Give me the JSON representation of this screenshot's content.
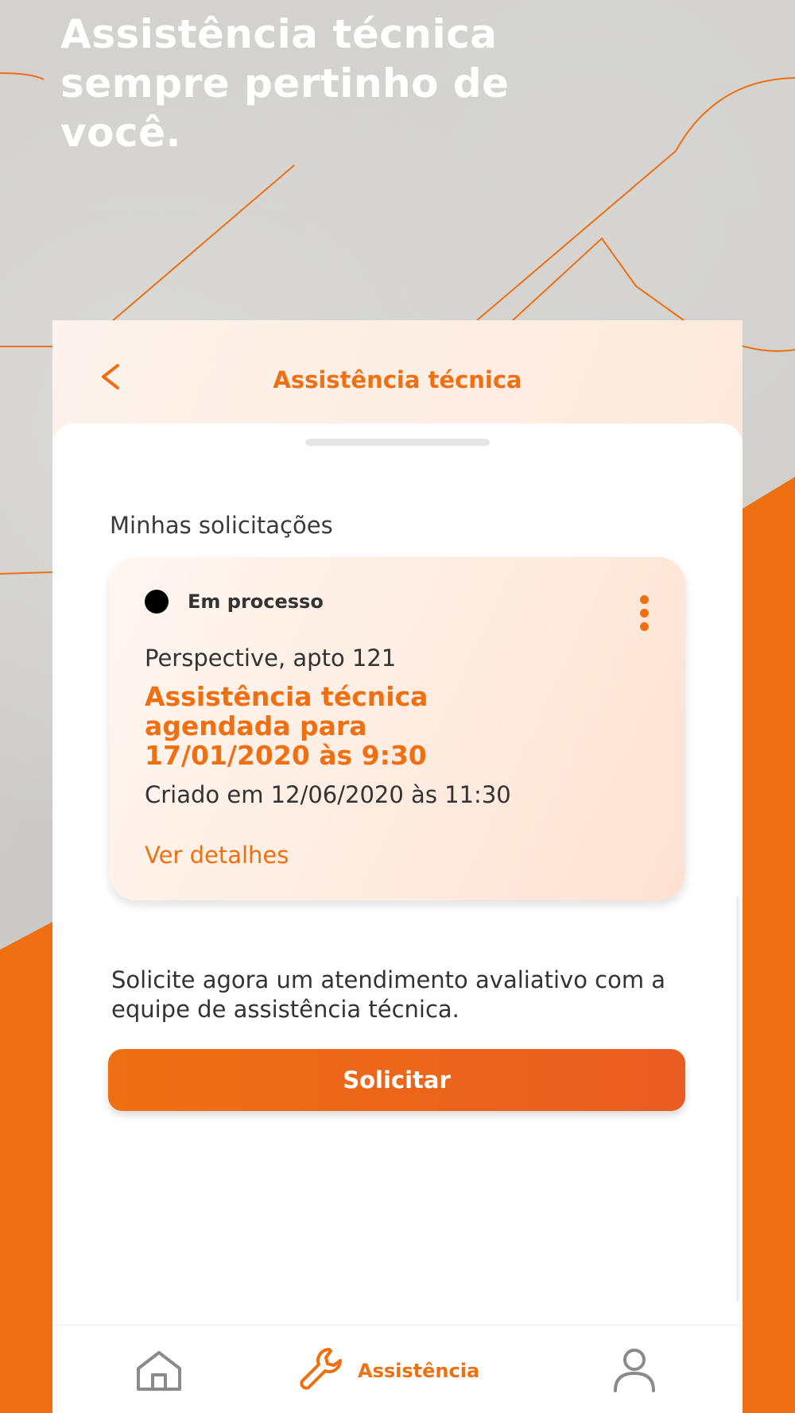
{
  "promo": {
    "headline": "Assistência técnica sempre pertinho de você."
  },
  "app_bar": {
    "back_icon": "chevron-left-icon",
    "title": "Assistência técnica"
  },
  "requests": {
    "section_title": "Minhas solicitações",
    "items": [
      {
        "status": "Em processo",
        "address": "Perspective, apto 121",
        "schedule": "Assistência técnica agendada para 17/01/2020 às 9:30",
        "created": "Criado em 12/06/2020 às 11:30",
        "details_link": "Ver detalhes"
      }
    ]
  },
  "cta": {
    "description": "Solicite agora um atendimento avaliativo com a equipe de assistência técnica.",
    "button_label": "Solicitar"
  },
  "bottom_nav": {
    "items": [
      {
        "icon": "home-icon",
        "label": ""
      },
      {
        "icon": "wrench-icon",
        "label": "Assistência",
        "active": true
      },
      {
        "icon": "user-icon",
        "label": ""
      }
    ]
  },
  "colors": {
    "accent": "#ee7012",
    "status_dot": "#000000",
    "inactive_icon": "#8a8a8a"
  }
}
